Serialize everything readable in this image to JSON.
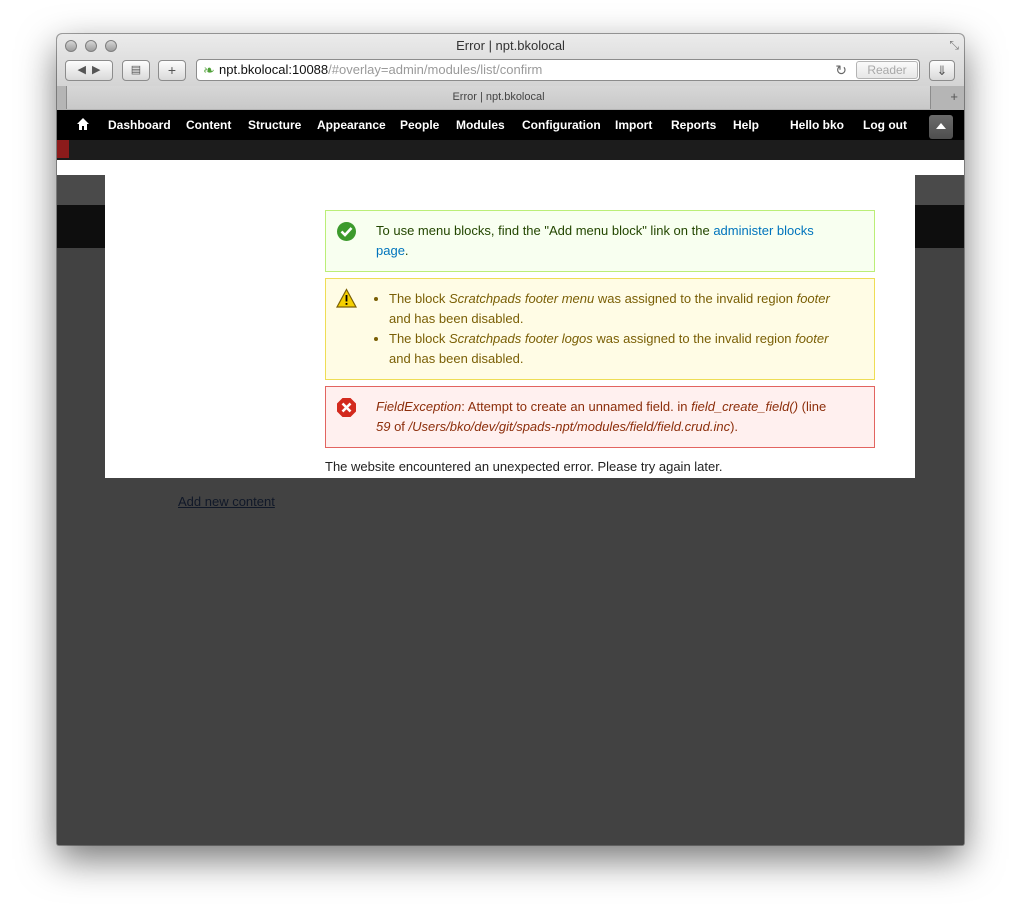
{
  "window": {
    "title": "Error | npt.bkolocal",
    "tab_title": "Error | npt.bkolocal"
  },
  "address_bar": {
    "host": "npt.bkolocal:10088",
    "path": "/#overlay=admin/modules/list/confirm",
    "reader_label": "Reader"
  },
  "admin_menu": {
    "items": [
      "Dashboard",
      "Content",
      "Structure",
      "Appearance",
      "People",
      "Modules",
      "Configuration",
      "Import",
      "Reports",
      "Help"
    ],
    "hello_prefix": "Hello ",
    "username": "bko",
    "logout": "Log out"
  },
  "messages": {
    "status": {
      "text": "To use menu blocks, find the \"Add menu block\" link on the ",
      "link": "administer blocks page",
      "suffix": "."
    },
    "warnings": [
      {
        "prefix": "The block ",
        "block": "Scratchpads footer menu",
        "middle": " was assigned to the invalid region ",
        "region": "footer",
        "suffix": " and has been disabled."
      },
      {
        "prefix": "The block ",
        "block": "Scratchpads footer logos",
        "middle": " was assigned to the invalid region ",
        "region": "footer",
        "suffix": " and has been disabled."
      }
    ],
    "error": {
      "exception": "FieldException",
      "message": ": Attempt to create an unnamed field. in ",
      "function": "field_create_field()",
      "line_prefix": " (line ",
      "line": "59",
      "of": " of ",
      "file": "/Users/bko/dev/git/spads-npt/modules/field/field.crud.inc",
      "suffix": ")."
    }
  },
  "site_error": "The website encountered an unexpected error. Please try again later.",
  "add_new_content": "Add new content",
  "colors": {
    "status_bg": "#f8fff0",
    "warning_bg": "#fffce5",
    "error_bg": "#fff0ef",
    "link": "#0074bd"
  },
  "icons": [
    "home-icon",
    "check-icon",
    "warning-icon",
    "error-icon",
    "reload-icon"
  ]
}
